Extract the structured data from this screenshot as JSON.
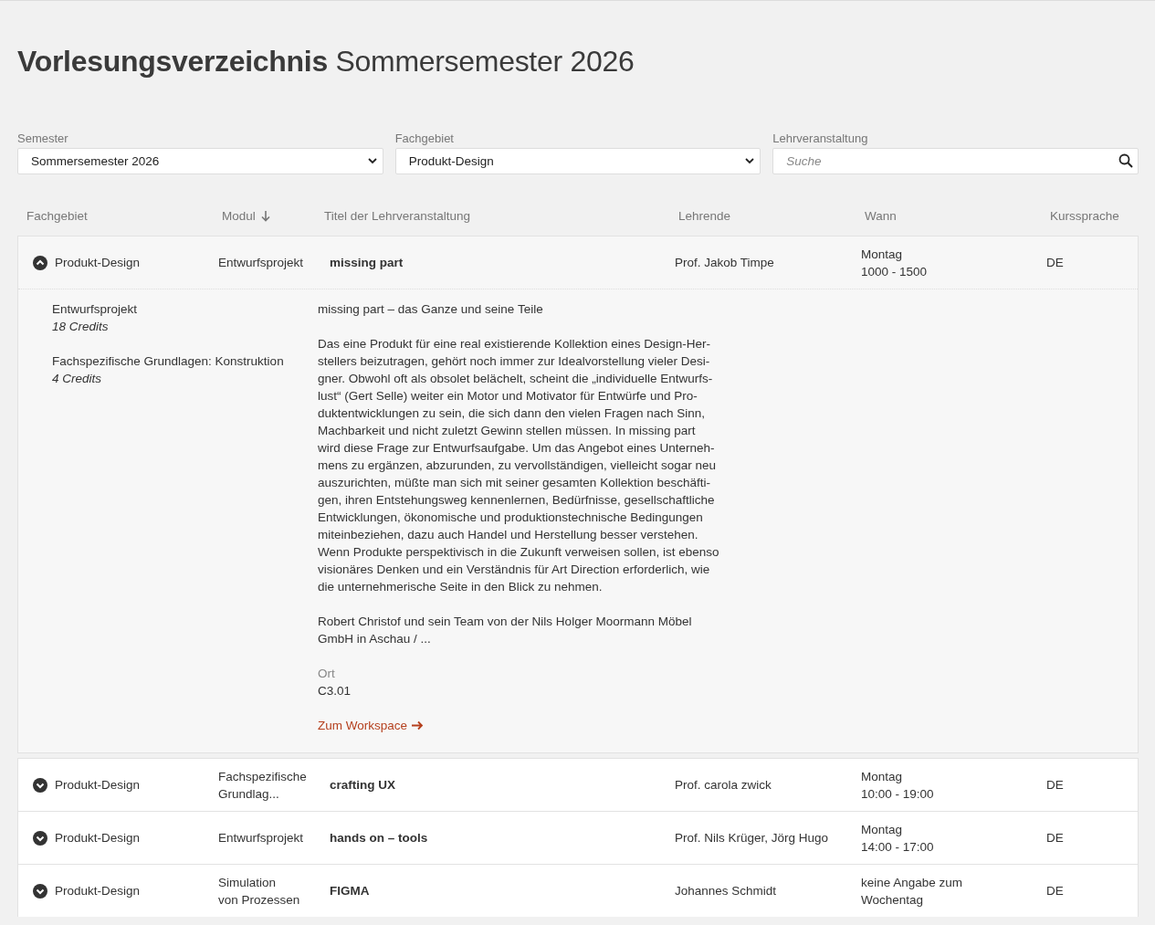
{
  "title": "**Vorlesungsverzeichnis** Sommersemester 2026",
  "filters": [
    {
      "kind": "select",
      "label": "Semester",
      "value": "Sommersemester 2026"
    },
    {
      "kind": "select",
      "label": "Fachgebiet",
      "value": "Produkt-Design"
    },
    {
      "kind": "search",
      "label": "Lehrveranstaltung",
      "placeholder": "Suche"
    }
  ],
  "table": {
    "columns": [
      {
        "label": "Fachgebiet",
        "sorted": false
      },
      {
        "label": "Modul",
        "sorted": true
      },
      {
        "label": "Titel der Lehrveranstaltung",
        "sorted": false
      },
      {
        "label": "Lehrende",
        "sorted": false
      },
      {
        "label": "Wann",
        "sorted": false
      },
      {
        "label": "Kurssprache",
        "sorted": false
      }
    ],
    "rows": [
      {
        "expanded": true,
        "fachgebiet": "Produkt-Design",
        "modul": [
          "Entwurfsprojekt"
        ],
        "title": "missing part",
        "lehrende": "Prof. Jakob Timpe",
        "wann": [
          "Montag",
          "1000 - 1500"
        ],
        "sprache": "DE",
        "details": {
          "modules": [
            {
              "name": "Entwurfsprojekt",
              "credits": "18 Credits"
            },
            {
              "name": "Fachspezifische Grundlagen: Konstruktion",
              "credits": "4 Credits"
            }
          ],
          "heading": "missing part – das Ganze und seine Teile",
          "paragraphs": [
            [
              "Das eine Produkt für eine real existierende Kollektion eines Design-Her-",
              "stellers beizutragen, gehört noch immer zur Idealvorstellung vieler Desi-",
              "gner. Obwohl oft als obsolet belächelt, scheint die „individuelle Entwurfs-",
              "lust“ (Gert Selle) weiter ein Motor und Motivator für Entwürfe und Pro-",
              "duktentwicklungen zu sein, die sich dann den vielen Fragen nach Sinn,",
              "Machbarkeit und nicht zuletzt Gewinn stellen müssen. In missing part",
              "wird diese Frage zur Entwurfsaufgabe. Um das Angebot eines Unterneh-",
              "mens zu ergänzen, abzurunden, zu vervollständigen, vielleicht sogar neu",
              "auszurichten, müßte man sich mit seiner gesamten Kollektion beschäfti-",
              "gen, ihren Entstehungsweg kennenlernen, Bedürfnisse, gesellschaftliche",
              "Entwicklungen, ökonomische und produktionstechnische Bedingungen",
              "miteinbeziehen, dazu auch Handel und Herstellung besser verstehen.",
              "Wenn Produkte perspektivisch in die Zukunft verweisen sollen, ist ebenso",
              "visionäres Denken und ein Verständnis für Art Direction erforderlich, wie",
              "die unternehmerische Seite in den Blick zu nehmen."
            ],
            [
              "Robert Christof und sein Team von der Nils Holger Moormann Möbel",
              "GmbH in Aschau / ..."
            ]
          ],
          "ort_label": "Ort",
          "ort": "C3.01",
          "link": "Zum Workspace"
        }
      },
      {
        "expanded": false,
        "fachgebiet": "Produkt-Design",
        "modul": [
          "Fachspezifische",
          "Grundlag..."
        ],
        "title": "crafting UX",
        "lehrende": "Prof. carola zwick",
        "wann": [
          "Montag",
          "10:00 - 19:00"
        ],
        "sprache": "DE"
      },
      {
        "expanded": false,
        "fachgebiet": "Produkt-Design",
        "modul": [
          "Entwurfsprojekt"
        ],
        "title": "hands on – tools",
        "lehrende": "Prof. Nils Krüger, Jörg Hugo",
        "wann": [
          "Montag",
          "14:00 - 17:00"
        ],
        "sprache": "DE"
      },
      {
        "expanded": false,
        "fachgebiet": "Produkt-Design",
        "modul": [
          "Simulation",
          "von Prozessen"
        ],
        "title": "FIGMA",
        "lehrende": "Johannes Schmidt",
        "wann": [
          "keine Angabe zum",
          "Wochentag"
        ],
        "sprache": "DE"
      }
    ]
  }
}
